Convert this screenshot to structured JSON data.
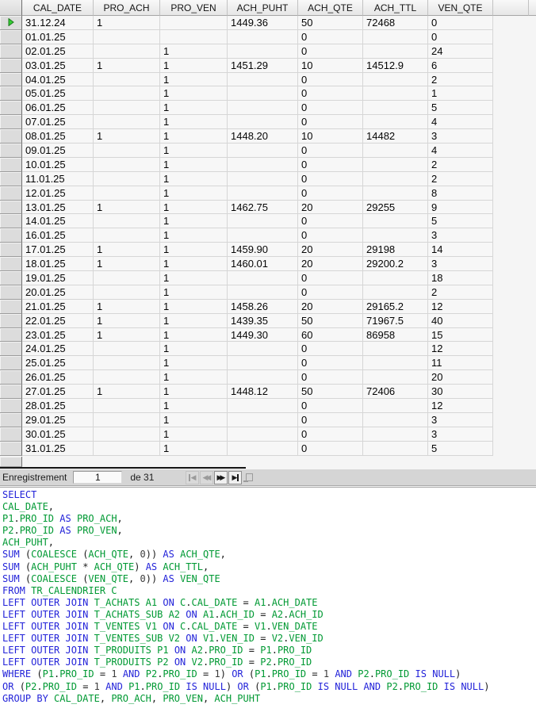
{
  "grid": {
    "columns": [
      "CAL_DATE",
      "PRO_ACH",
      "PRO_VEN",
      "ACH_PUHT",
      "ACH_QTE",
      "ACH_TTL",
      "VEN_QTE"
    ],
    "rows": [
      [
        "31.12.24",
        "1",
        "",
        "1449.36",
        "50",
        "72468",
        "0"
      ],
      [
        "01.01.25",
        "",
        "",
        "",
        "0",
        "",
        "0"
      ],
      [
        "02.01.25",
        "",
        "1",
        "",
        "0",
        "",
        "24"
      ],
      [
        "03.01.25",
        "1",
        "1",
        "1451.29",
        "10",
        "14512.9",
        "6"
      ],
      [
        "04.01.25",
        "",
        "1",
        "",
        "0",
        "",
        "2"
      ],
      [
        "05.01.25",
        "",
        "1",
        "",
        "0",
        "",
        "1"
      ],
      [
        "06.01.25",
        "",
        "1",
        "",
        "0",
        "",
        "5"
      ],
      [
        "07.01.25",
        "",
        "1",
        "",
        "0",
        "",
        "4"
      ],
      [
        "08.01.25",
        "1",
        "1",
        "1448.20",
        "10",
        "14482",
        "3"
      ],
      [
        "09.01.25",
        "",
        "1",
        "",
        "0",
        "",
        "4"
      ],
      [
        "10.01.25",
        "",
        "1",
        "",
        "0",
        "",
        "2"
      ],
      [
        "11.01.25",
        "",
        "1",
        "",
        "0",
        "",
        "2"
      ],
      [
        "12.01.25",
        "",
        "1",
        "",
        "0",
        "",
        "8"
      ],
      [
        "13.01.25",
        "1",
        "1",
        "1462.75",
        "20",
        "29255",
        "9"
      ],
      [
        "14.01.25",
        "",
        "1",
        "",
        "0",
        "",
        "5"
      ],
      [
        "16.01.25",
        "",
        "1",
        "",
        "0",
        "",
        "3"
      ],
      [
        "17.01.25",
        "1",
        "1",
        "1459.90",
        "20",
        "29198",
        "14"
      ],
      [
        "18.01.25",
        "1",
        "1",
        "1460.01",
        "20",
        "29200.2",
        "3"
      ],
      [
        "19.01.25",
        "",
        "1",
        "",
        "0",
        "",
        "18"
      ],
      [
        "20.01.25",
        "",
        "1",
        "",
        "0",
        "",
        "2"
      ],
      [
        "21.01.25",
        "1",
        "1",
        "1458.26",
        "20",
        "29165.2",
        "12"
      ],
      [
        "22.01.25",
        "1",
        "1",
        "1439.35",
        "50",
        "71967.5",
        "40"
      ],
      [
        "23.01.25",
        "1",
        "1",
        "1449.30",
        "60",
        "86958",
        "15"
      ],
      [
        "24.01.25",
        "",
        "1",
        "",
        "0",
        "",
        "12"
      ],
      [
        "25.01.25",
        "",
        "1",
        "",
        "0",
        "",
        "11"
      ],
      [
        "26.01.25",
        "",
        "1",
        "",
        "0",
        "",
        "20"
      ],
      [
        "27.01.25",
        "1",
        "1",
        "1448.12",
        "50",
        "72406",
        "30"
      ],
      [
        "28.01.25",
        "",
        "1",
        "",
        "0",
        "",
        "12"
      ],
      [
        "29.01.25",
        "",
        "1",
        "",
        "0",
        "",
        "3"
      ],
      [
        "30.01.25",
        "",
        "1",
        "",
        "0",
        "",
        "3"
      ],
      [
        "31.01.25",
        "",
        "1",
        "",
        "0",
        "",
        "5"
      ]
    ],
    "current_row_index": 0,
    "marker_color": "#33cc33"
  },
  "navigator": {
    "label": "Enregistrement",
    "record_value": "1",
    "of_text": "de 31",
    "buttons": [
      "first-record",
      "previous-record",
      "next-record",
      "last-record",
      "new-record"
    ]
  },
  "sql": {
    "keywords": [
      "SELECT",
      "AS",
      "SUM",
      "FROM",
      "LEFT",
      "OUTER",
      "JOIN",
      "ON",
      "WHERE",
      "AND",
      "OR",
      "IS",
      "NULL",
      "GROUP",
      "BY"
    ],
    "colors": {
      "keyword": "#2323d9",
      "identifier": "#009933",
      "number": "#3c3c3c",
      "punctuation": "#1a1a1a"
    },
    "lines": [
      "SELECT",
      "CAL_DATE,",
      "P1.PRO_ID AS PRO_ACH,",
      "P2.PRO_ID AS PRO_VEN,",
      "ACH_PUHT,",
      "SUM (COALESCE (ACH_QTE, 0)) AS ACH_QTE,",
      "SUM (ACH_PUHT * ACH_QTE) AS ACH_TTL,",
      "SUM (COALESCE (VEN_QTE, 0)) AS VEN_QTE",
      "FROM TR_CALENDRIER C",
      "LEFT OUTER JOIN T_ACHATS A1 ON C.CAL_DATE = A1.ACH_DATE",
      "LEFT OUTER JOIN T_ACHATS_SUB A2 ON A1.ACH_ID = A2.ACH_ID",
      "LEFT OUTER JOIN T_VENTES V1 ON C.CAL_DATE = V1.VEN_DATE",
      "LEFT OUTER JOIN T_VENTES_SUB V2 ON V1.VEN_ID = V2.VEN_ID",
      "LEFT OUTER JOIN T_PRODUITS P1 ON A2.PRO_ID = P1.PRO_ID",
      "LEFT OUTER JOIN T_PRODUITS P2 ON V2.PRO_ID = P2.PRO_ID",
      "WHERE (P1.PRO_ID = 1 AND P2.PRO_ID = 1) OR (P1.PRO_ID = 1 AND P2.PRO_ID IS NULL)",
      "OR (P2.PRO_ID = 1 AND P1.PRO_ID IS NULL) OR (P1.PRO_ID IS NULL AND P2.PRO_ID IS NULL)",
      "GROUP BY CAL_DATE, PRO_ACH, PRO_VEN, ACH_PUHT"
    ]
  }
}
